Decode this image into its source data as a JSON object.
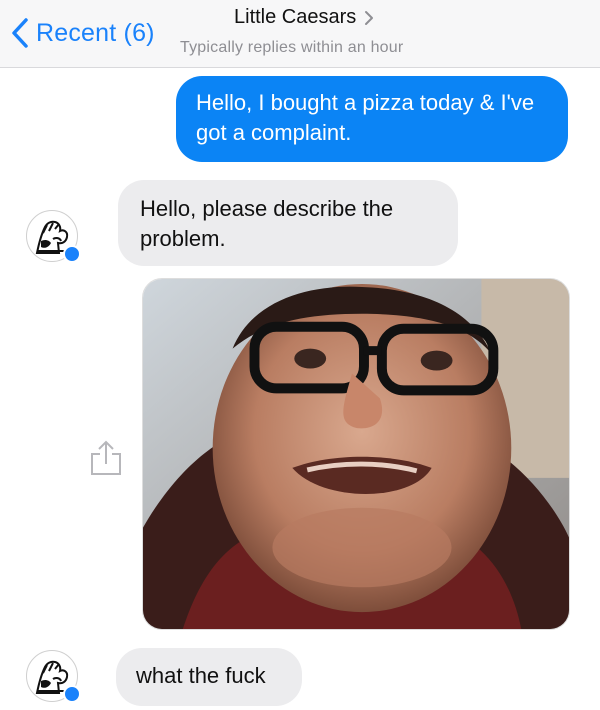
{
  "header": {
    "back_label": "Recent (6)",
    "contact_name": "Little Caesars",
    "status": "Typically replies within an hour"
  },
  "messages": [
    {
      "from": "me",
      "text": "Hello, I bought a pizza today & I've got a complaint."
    },
    {
      "from": "them",
      "text": "Hello, please describe the problem."
    },
    {
      "from": "them",
      "type": "photo"
    },
    {
      "from": "them",
      "text": "what the fuck"
    }
  ],
  "colors": {
    "accent": "#1a82fb",
    "outgoing_bubble": "#0b84f5",
    "incoming_bubble": "#ececee",
    "status_text": "#8e8e93"
  },
  "icons": {
    "back": "chevron-left-icon",
    "title_chevron": "chevron-right-icon",
    "share": "share-icon",
    "avatar_badge": "messenger-badge-icon"
  }
}
